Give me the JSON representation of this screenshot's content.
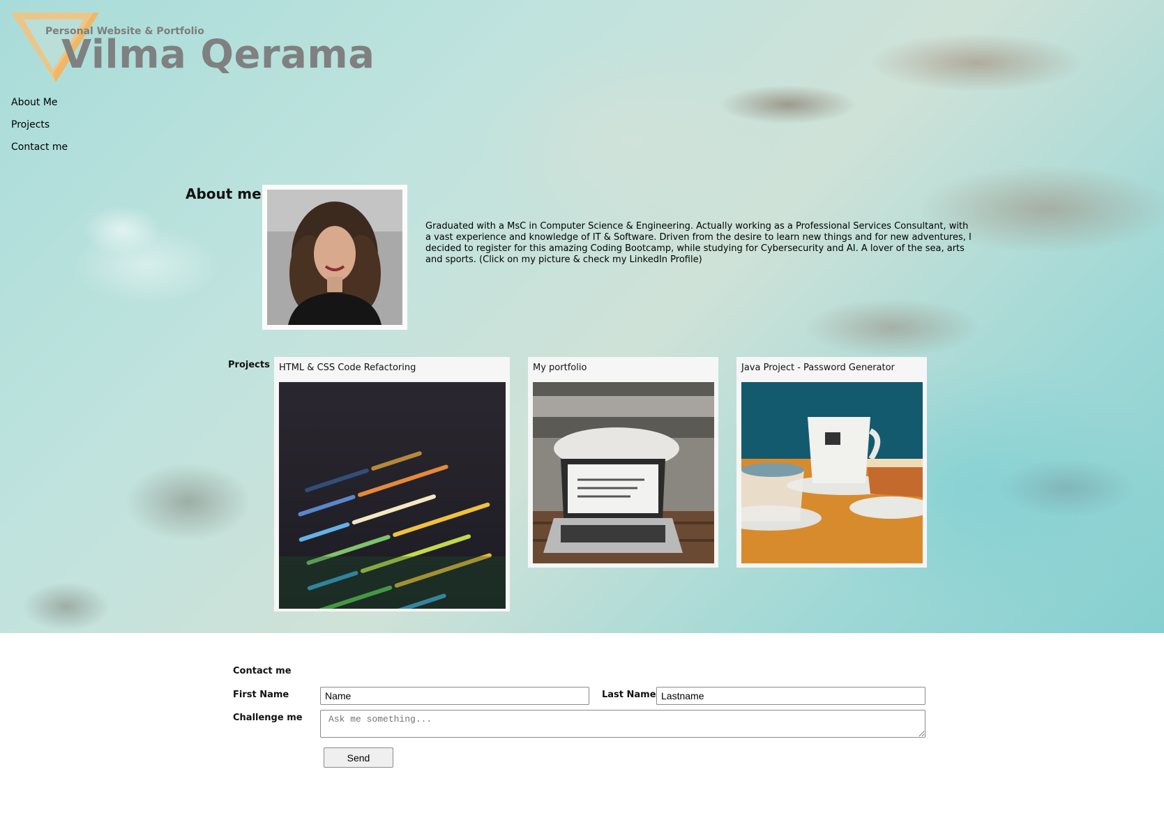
{
  "header": {
    "subtitle": "Personal Website & Portfolio",
    "name": "Vilma Qerama",
    "logo_icon": "v-triangle-logo-icon",
    "accent_color": "#f7c27a"
  },
  "nav": {
    "items": [
      {
        "label": "About Me"
      },
      {
        "label": "Projects"
      },
      {
        "label": "Contact me"
      }
    ]
  },
  "about": {
    "heading": "About me",
    "photo_icon": "profile-photo",
    "text": "Graduated with a MsC in Computer Science & Engineering. Actually working as a Professional Services Consultant, with a vast experience and knowledge of IT & Software. Driven from the desire to learn new things and for new adventures, I decided to register for this amazing Coding Bootcamp, while studying for Cybersecurity and AI. A lover of the sea, arts and sports. (Click on my picture & check my LinkedIn Profile)"
  },
  "projects": {
    "label": "Projects",
    "items": [
      {
        "title": "HTML & CSS Code Refactoring",
        "image": "code-screen-image"
      },
      {
        "title": "My portfolio",
        "image": "laptop-image"
      },
      {
        "title": "Java Project - Password Generator",
        "image": "coffee-cups-image"
      }
    ]
  },
  "contact": {
    "heading": "Contact me",
    "first_name_label": "First Name",
    "first_name_value": "Name",
    "last_name_label": "Last Name",
    "last_name_value": "Lastname",
    "message_label": "Challenge me",
    "message_placeholder": "Ask me something...",
    "send_label": "Send"
  }
}
